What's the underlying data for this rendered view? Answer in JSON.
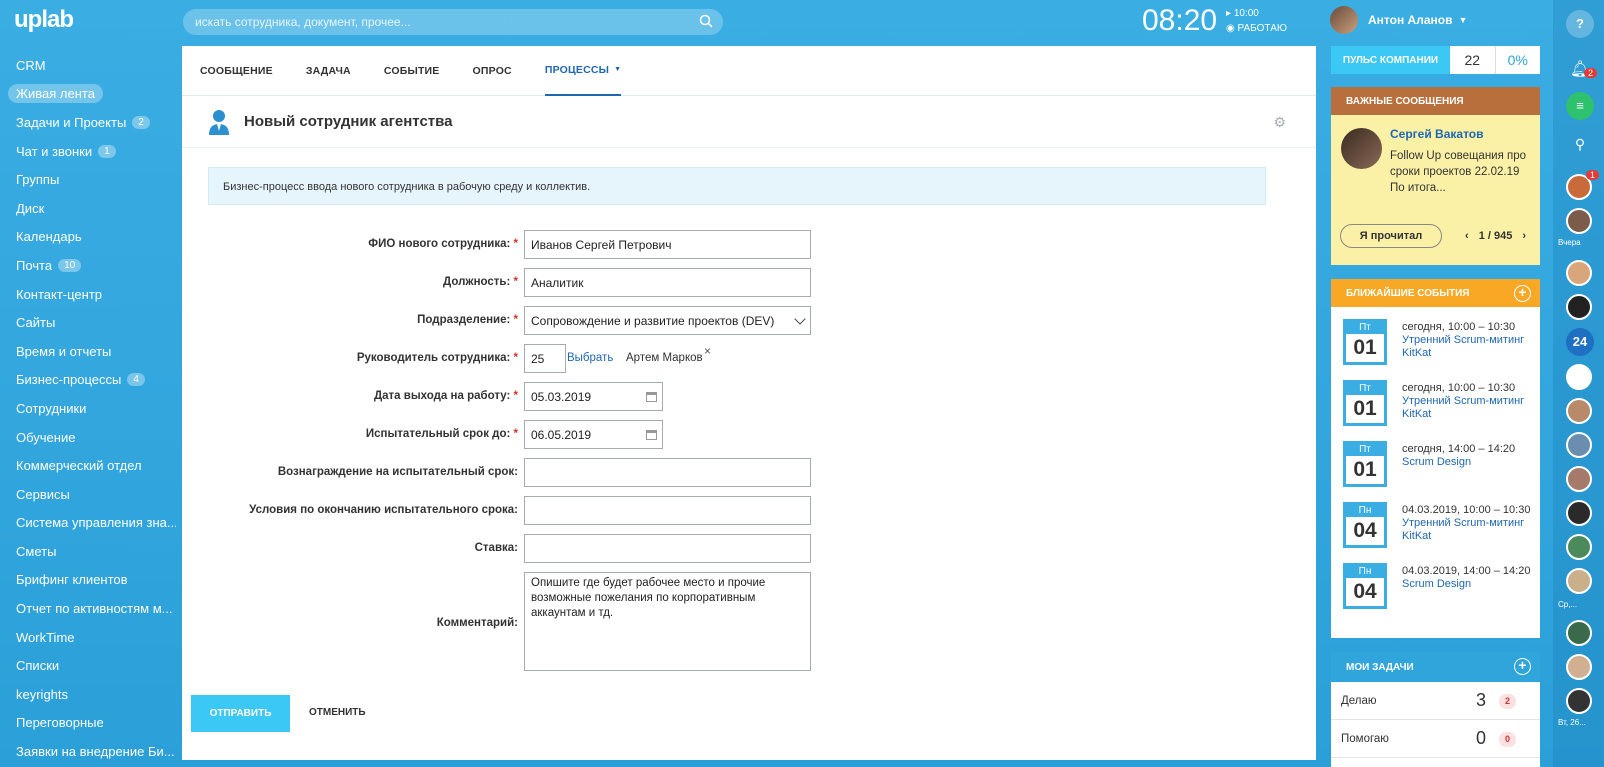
{
  "topbar": {
    "logo": "uplab",
    "search_placeholder": "искать сотрудника, документ, прочее...",
    "time": "08:20",
    "time_small": "10:00",
    "status": "РАБОТАЮ",
    "user_name": "Антон Аланов"
  },
  "menu": [
    {
      "label": "CRM"
    },
    {
      "label": "Живая лента",
      "active": true
    },
    {
      "label": "Задачи и Проекты",
      "badge": "2"
    },
    {
      "label": "Чат и звонки",
      "badge": "1"
    },
    {
      "label": "Группы"
    },
    {
      "label": "Диск"
    },
    {
      "label": "Календарь"
    },
    {
      "label": "Почта",
      "badge": "10"
    },
    {
      "label": "Контакт-центр"
    },
    {
      "label": "Сайты"
    },
    {
      "label": "Время и отчеты"
    },
    {
      "label": "Бизнес-процессы",
      "badge": "4"
    },
    {
      "label": "Сотрудники"
    },
    {
      "label": "Обучение"
    },
    {
      "label": "Коммерческий отдел"
    },
    {
      "label": "Сервисы"
    },
    {
      "label": "Система управления зна..."
    },
    {
      "label": "Сметы"
    },
    {
      "label": "Брифинг клиентов"
    },
    {
      "label": "Отчет по активностям м..."
    },
    {
      "label": "WorkTime"
    },
    {
      "label": "Списки"
    },
    {
      "label": "keyrights"
    },
    {
      "label": "Переговорные"
    },
    {
      "label": "Заявки на внедрение Би..."
    }
  ],
  "tabs": [
    "СООБЩЕНИЕ",
    "ЗАДАЧА",
    "СОБЫТИЕ",
    "ОПРОС",
    "ПРОЦЕССЫ"
  ],
  "form": {
    "title": "Новый сотрудник агентства",
    "description": "Бизнес-процесс ввода нового сотрудника в рабочую среду и коллектив.",
    "fields": {
      "fio": {
        "label": "ФИО нового сотрудника:",
        "value": "Иванов Сергей Петрович"
      },
      "position": {
        "label": "Должность:",
        "value": "Аналитик"
      },
      "department": {
        "label": "Подразделение:",
        "value": "Сопровождение и развитие проектов (DEV)"
      },
      "manager": {
        "label": "Руководитель сотрудника:",
        "value": "25",
        "choose": "Выбрать",
        "name": "Артем Марков"
      },
      "start_date": {
        "label": "Дата выхода на работу:",
        "value": "05.03.2019"
      },
      "probation_end": {
        "label": "Испытательный срок до:",
        "value": "06.05.2019"
      },
      "reward": {
        "label": "Вознаграждение на испытательный срок:",
        "value": ""
      },
      "conditions": {
        "label": "Условия по окончанию испытательного срока:",
        "value": ""
      },
      "rate": {
        "label": "Ставка:",
        "value": ""
      },
      "comment": {
        "label": "Комментарий:",
        "value": "Опишите где будет рабочее место и прочие возможные пожелания по корпоративным аккаунтам и тд."
      }
    },
    "submit": "ОТПРАВИТЬ",
    "cancel": "ОТМЕНИТЬ"
  },
  "pulse": {
    "label": "ПУЛЬС КОМПАНИИ",
    "value": "22",
    "percent": "0%"
  },
  "important": {
    "header": "ВАЖНЫЕ СООБЩЕНИЯ",
    "author": "Сергей Вакатов",
    "message": "Follow Up совещания про сроки проектов 22.02.19 По итога...",
    "read_button": "Я прочитал",
    "pager": "1 / 945"
  },
  "events": {
    "header": "БЛИЖАЙШИЕ СОБЫТИЯ",
    "items": [
      {
        "dow": "Пт",
        "day": "01",
        "time": "сегодня, 10:00 – 10:30",
        "title": "Утренний Scrum-митинг KitKat"
      },
      {
        "dow": "Пт",
        "day": "01",
        "time": "сегодня, 10:00 – 10:30",
        "title": "Утренний Scrum-митинг KitKat"
      },
      {
        "dow": "Пт",
        "day": "01",
        "time": "сегодня, 14:00 – 14:20",
        "title": "Scrum Design"
      },
      {
        "dow": "Пн",
        "day": "04",
        "time": "04.03.2019, 10:00 – 10:30",
        "title": "Утренний Scrum-митинг KitKat"
      },
      {
        "dow": "Пн",
        "day": "04",
        "time": "04.03.2019, 14:00 – 14:20",
        "title": "Scrum Design"
      }
    ]
  },
  "tasks": {
    "header": "МОИ ЗАДАЧИ",
    "rows": [
      {
        "label": "Делаю",
        "count": "3",
        "badge": "2"
      },
      {
        "label": "Помогаю",
        "count": "0",
        "badge": "0"
      }
    ]
  },
  "farbar": {
    "help": "?",
    "notif_badge": "2",
    "avatar_badge": "1",
    "label_yesterday": "Вчера",
    "label_wed": "Ср,...",
    "label_tue": "Вт, 26..."
  },
  "colors": {
    "bg": "#2fa5dc",
    "accent": "#3bc8f5",
    "important_bg": "#fbf1a6",
    "important_head": "#b86f3c",
    "events_head": "#f9a825",
    "link": "#2067b0"
  }
}
